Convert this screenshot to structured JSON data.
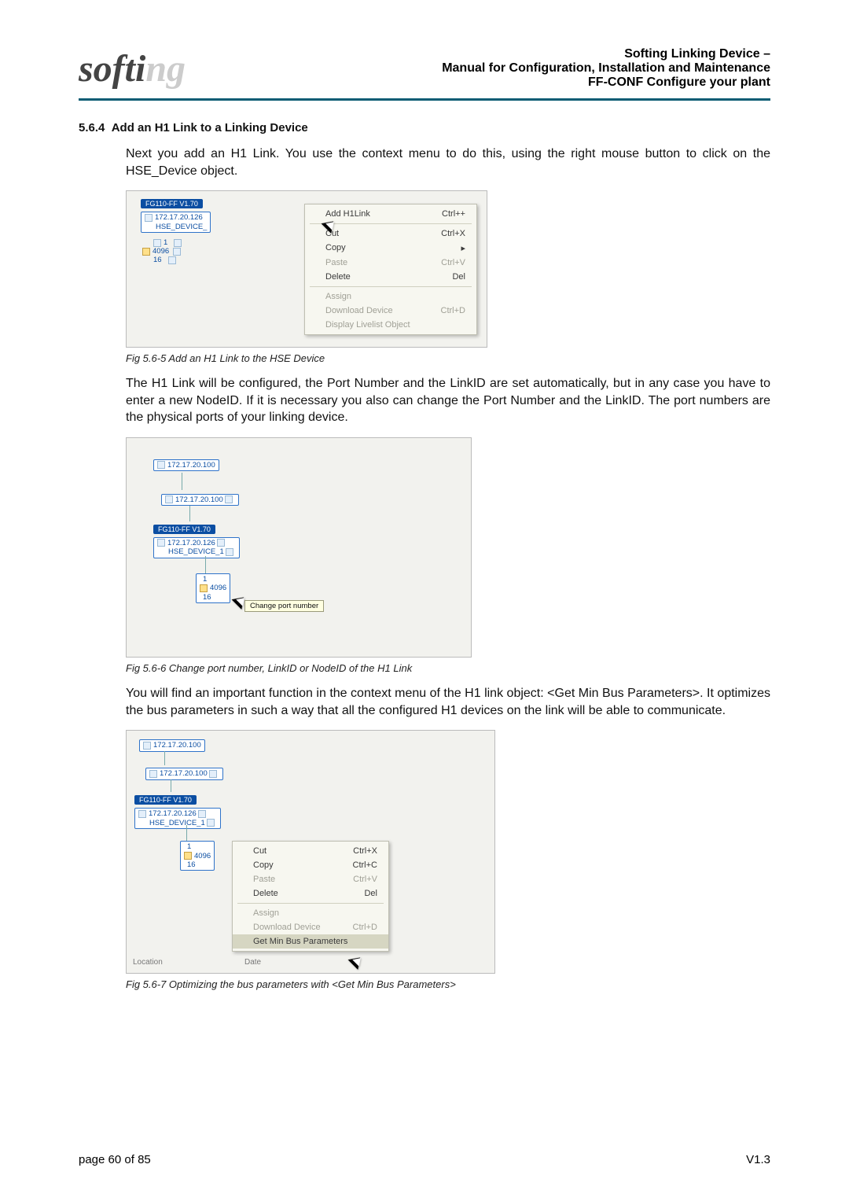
{
  "header": {
    "line1a": "Softing Linking Device –",
    "line2": "Manual for Configuration, Installation and Maintenance",
    "line3a": "FF-CONF Configure your plant"
  },
  "section": {
    "num": "5.6.4",
    "title": "Add an H1 Link to a Linking Device"
  },
  "p1": "Next you add an H1 Link. You use the context menu to do this, using the right mouse button to click on the HSE_Device object.",
  "shot1": {
    "device_ver": "FG110-FF V1.70",
    "ip_top": "172.17.20.126",
    "hse_label": "HSE_DEVICE_",
    "port_vals": {
      "a": "1",
      "b": "4096",
      "c": "16"
    },
    "menu": [
      {
        "label": "Add H1Link",
        "short": "Ctrl++"
      },
      {
        "label": "Cut",
        "short": "Ctrl+X"
      },
      {
        "label": "Copy",
        "short": "▸"
      },
      {
        "label": "Paste",
        "short": "Ctrl+V",
        "disabled": true
      },
      {
        "label": "Delete",
        "short": "Del"
      },
      {
        "label": "Assign",
        "short": "",
        "disabled": true
      },
      {
        "label": "Download Device",
        "short": "Ctrl+D",
        "disabled": true
      },
      {
        "label": "Display Livelist Object",
        "short": "",
        "disabled": true
      }
    ]
  },
  "cap1": "Fig 5.6-5  Add an H1 Link to the HSE Device",
  "p2": "The H1 Link will be configured, the Port Number and the LinkID are set automatically, but in any case you have to enter a new NodeID. If it is necessary you also can change the Port Number and the LinkID. The port numbers are the physical ports of your linking device.",
  "shot2": {
    "ip_root": "172.17.20.100",
    "ip_sub": "172.17.20.100",
    "device_ver": "FG110-FF V1.70",
    "ip_dev": "172.17.20.126",
    "hse_label": "HSE_DEVICE_1",
    "port_vals": {
      "a": "1",
      "b": "4096",
      "c": "16"
    },
    "tooltip": "Change port number"
  },
  "cap2": "Fig 5.6-6  Change port number, LinkID or NodeID of the H1 Link",
  "p3": "You will find an important function in the context menu of the H1 link object: <Get Min Bus Parameters>. It optimizes the bus parameters in such a way that all the configured H1 devices on the link will be able to communicate.",
  "shot3": {
    "ip_root": "172.17.20.100",
    "ip_sub": "172.17.20.100",
    "device_ver": "FG110-FF V1.70",
    "ip_dev": "172.17.20.126",
    "hse_label": "HSE_DEVICE_1",
    "port_vals": {
      "a": "1",
      "b": "4096",
      "c": "16"
    },
    "menu": [
      {
        "label": "Cut",
        "short": "Ctrl+X"
      },
      {
        "label": "Copy",
        "short": "Ctrl+C"
      },
      {
        "label": "Paste",
        "short": "Ctrl+V",
        "disabled": true
      },
      {
        "label": "Delete",
        "short": "Del"
      },
      {
        "label": "Assign",
        "short": "",
        "disabled": true
      },
      {
        "label": "Download Device",
        "short": "Ctrl+D",
        "disabled": true
      },
      {
        "label": "Get Min Bus Parameters",
        "short": "",
        "highlight": true
      }
    ],
    "footer_left": "Location",
    "footer_right": "Date"
  },
  "cap3": "Fig 5.6-7  Optimizing the bus parameters with <Get Min Bus Parameters>",
  "footer": {
    "left": "page 60 of 85",
    "right": "V1.3"
  }
}
